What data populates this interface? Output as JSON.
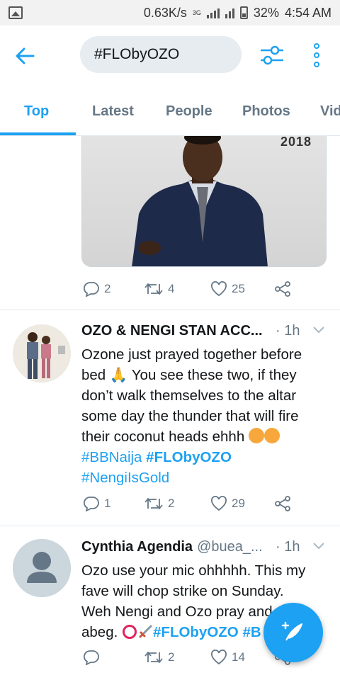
{
  "status_bar": {
    "speed": "0.63K/s",
    "network": "3G",
    "battery": "32%",
    "time": "4:54 AM"
  },
  "search": {
    "query": "#FLObyOZO"
  },
  "tabs": [
    {
      "label": "Top",
      "active": true
    },
    {
      "label": "Latest"
    },
    {
      "label": "People"
    },
    {
      "label": "Photos"
    },
    {
      "label": "Vid"
    }
  ],
  "photo_tweet": {
    "photo_year": "2018",
    "replies": "2",
    "retweets": "4",
    "likes": "25"
  },
  "tweets": [
    {
      "name": "OZO & NENGI STAN ACC...",
      "handle": "",
      "time": "· 1h",
      "text_lines": [
        "Ozone just prayed together before",
        "bed 🙏 You see these two, if they",
        "don’t walk themselves to the altar",
        "some day the thunder that will fire",
        "their coconut heads ehhh"
      ],
      "hashtags": [
        "#BBNaija",
        "#FLObyOZO",
        "#NengiIsGold"
      ],
      "replies": "1",
      "retweets": "2",
      "likes": "29"
    },
    {
      "name": "Cynthia Agendia",
      "handle": "@buea_...",
      "time": "· 1h",
      "text_lines": [
        "Ozo use your mic ohhhhh. This my",
        "fave will chop strike on Sunday.",
        "Weh Nengi and Ozo pray and chop",
        "abeg."
      ],
      "hashtags": [
        "#FLObyOZO",
        "#B"
      ],
      "replies": "",
      "retweets": "2",
      "likes": "14"
    }
  ],
  "colors": {
    "accent": "#1da1f2",
    "muted": "#657786",
    "search_bg": "#e6ecf0"
  },
  "icons": [
    "back-arrow-icon",
    "filter-icon",
    "more-vertical-icon",
    "reply-icon",
    "retweet-icon",
    "like-icon",
    "share-icon",
    "chevron-down-icon",
    "compose-icon"
  ]
}
